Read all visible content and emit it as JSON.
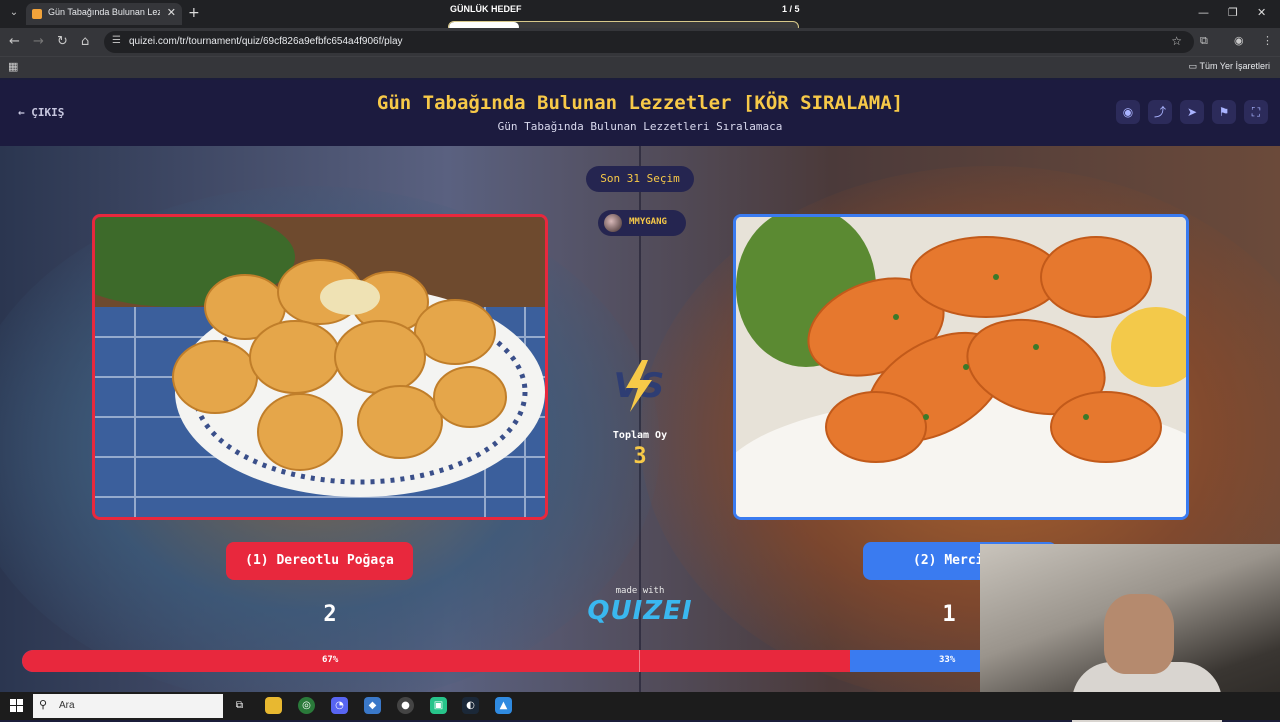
{
  "browser": {
    "tab_title": "Gün Tabağında Bulunan Lezzet...",
    "url": "quizei.com/tr/tournament/quiz/69cf826a9efbfc654a4f906f/play",
    "bookmarks_all": "Tüm Yer İşaretleri",
    "goal_label": "GÜNLÜK HEDEF",
    "goal_count": "1 / 5",
    "goal_progress": 0.2
  },
  "header": {
    "exit_label": "ÇIKIŞ",
    "title": "Gün Tabağında Bulunan Lezzetler [KÖR SIRALAMA]",
    "subtitle": "Gün Tabağında Bulunan Lezzetleri Sıralamaca"
  },
  "stage": {
    "last_choice": "Son 31 Seçim",
    "username": "MMYGANG",
    "vs": "VS",
    "total_label": "Toplam Oy",
    "total_value": "3",
    "made_with": "made with",
    "logo": "QUIZEI"
  },
  "options": [
    {
      "label": "(1) Dereotlu Poğaça",
      "votes": "2",
      "percent_text": "67%",
      "percent": 67,
      "color": "#e8283d"
    },
    {
      "label": "(2) Mercimek",
      "votes": "1",
      "percent_text": "33%",
      "percent": 33,
      "color": "#3a7bf0"
    }
  ],
  "taskbar": {
    "search_placeholder": "Ara"
  },
  "colors": {
    "accent": "#f7c948",
    "header_bg": "#1c1b3f"
  }
}
